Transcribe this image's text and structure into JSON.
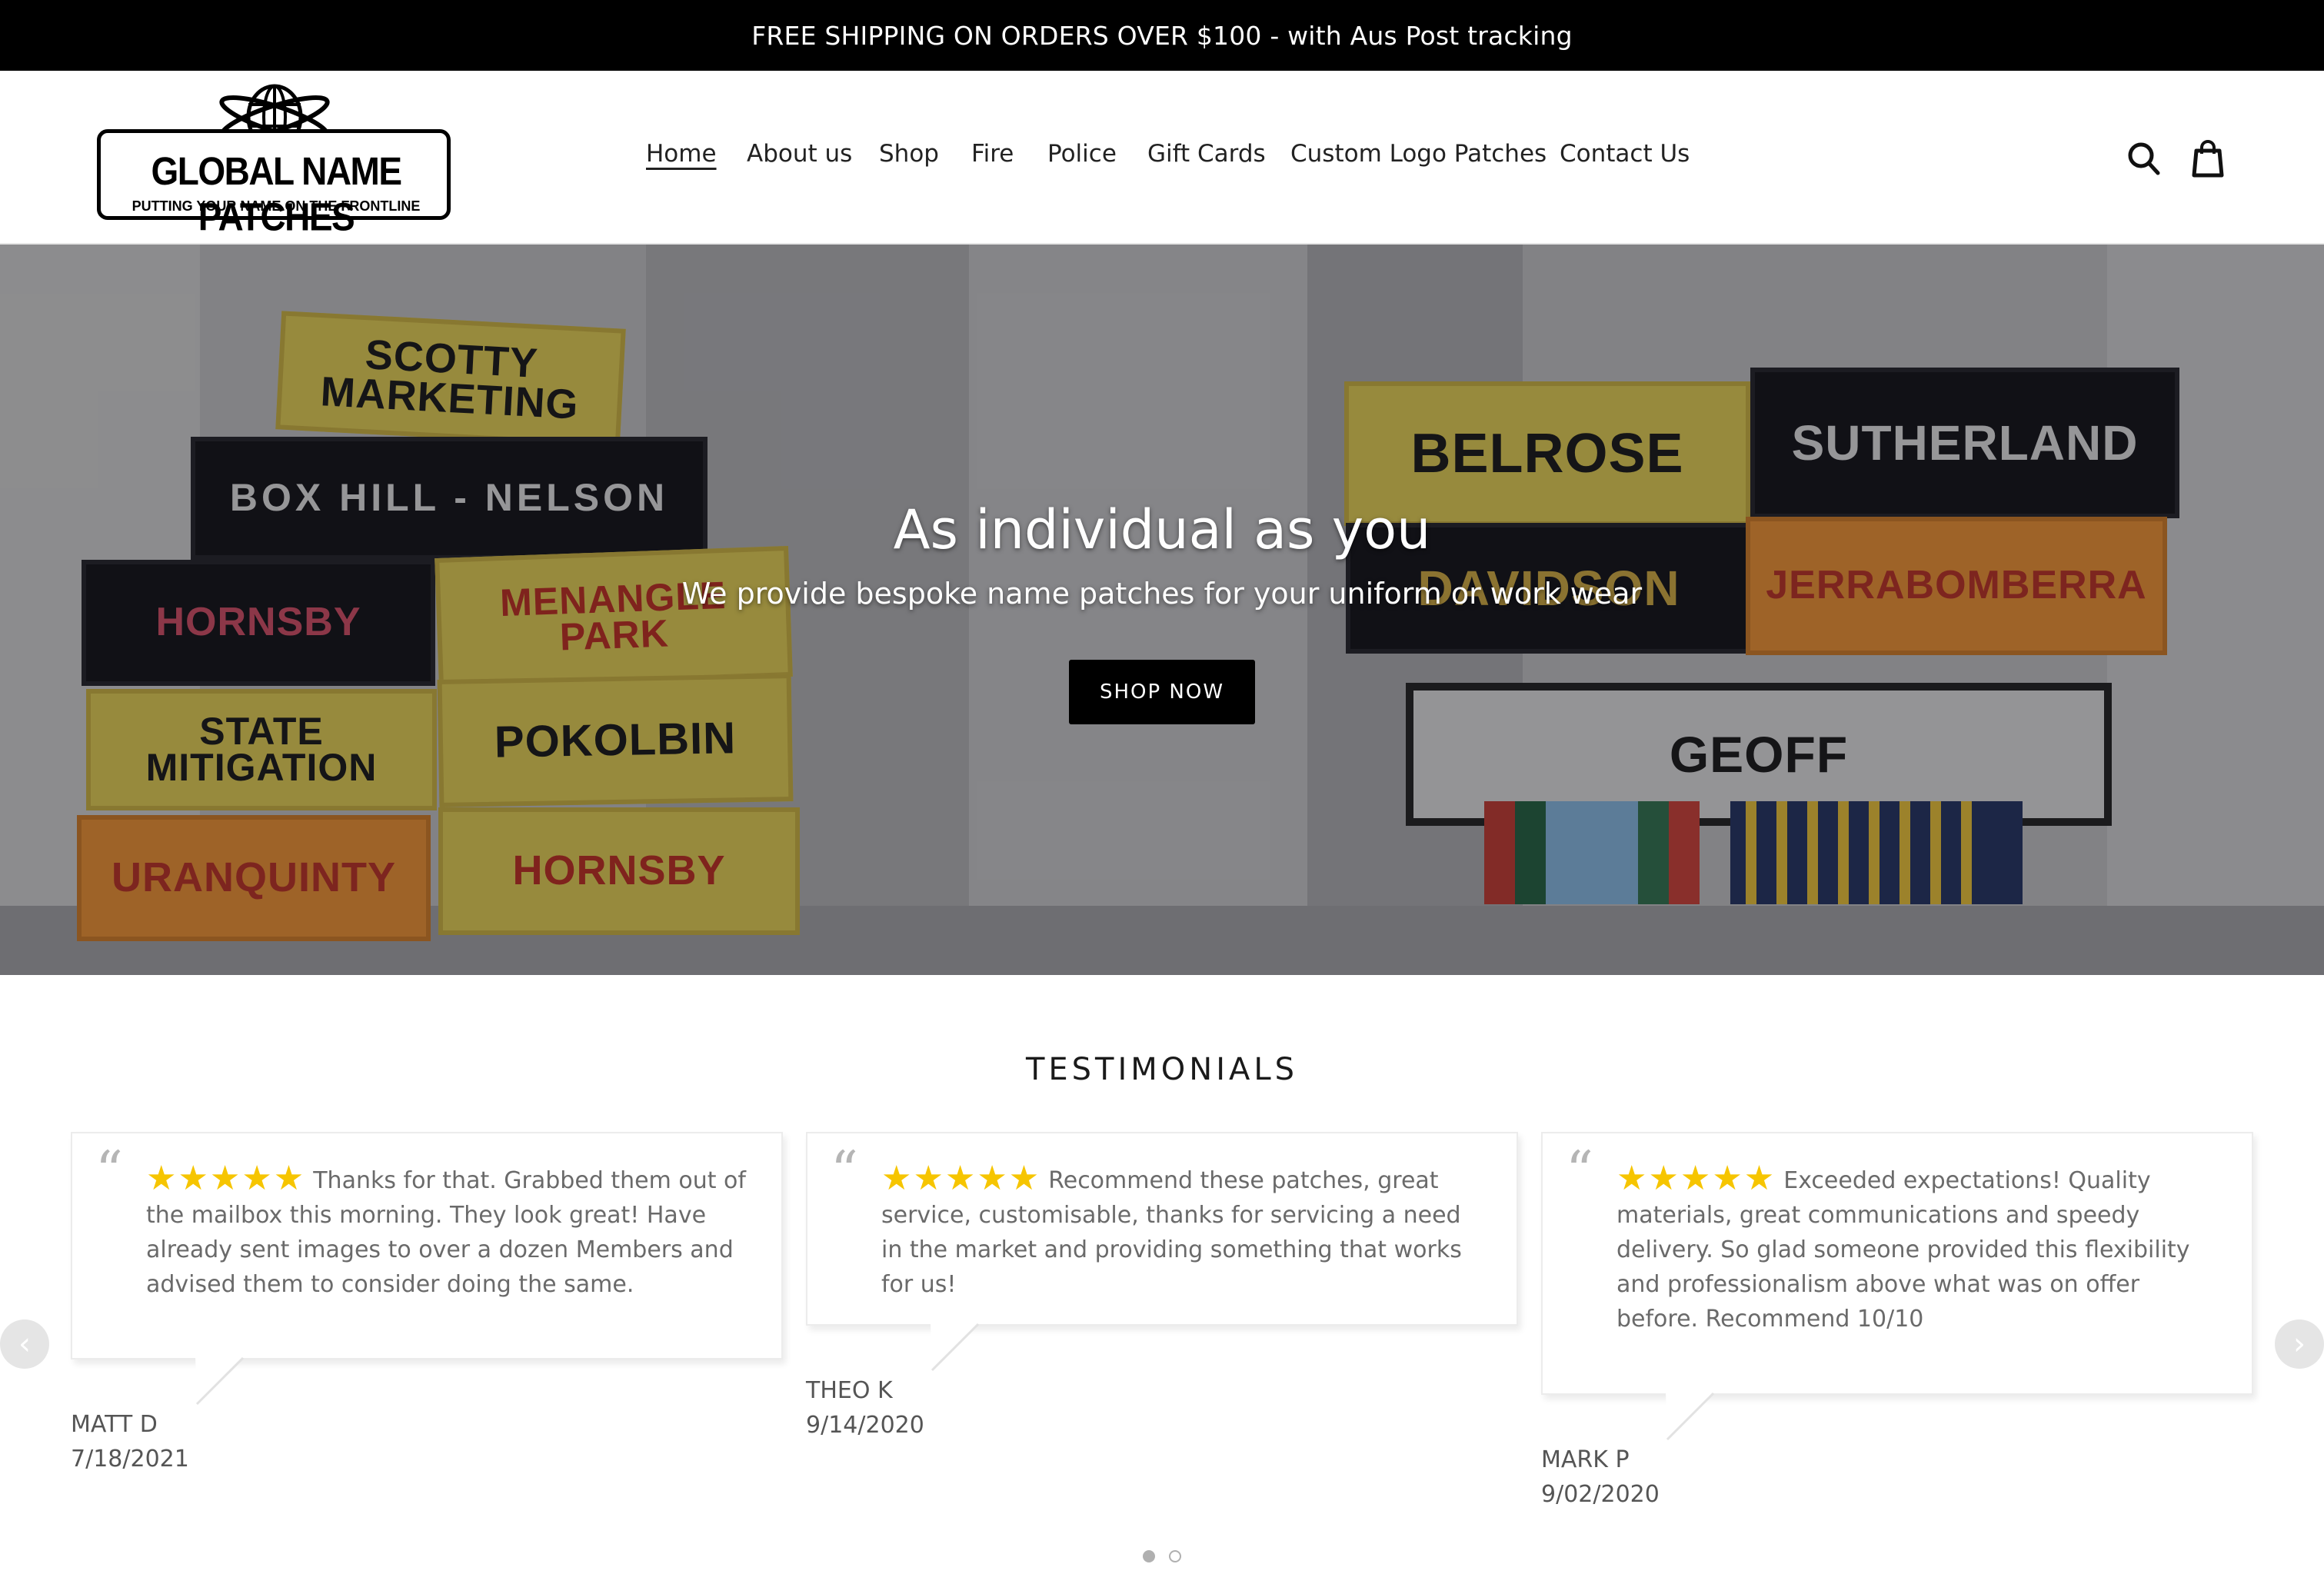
{
  "announcement": "FREE SHIPPING ON ORDERS OVER $100 - with Aus Post tracking",
  "logo": {
    "title": "GLOBAL NAME PATCHES",
    "tagline": "PUTTING YOUR NAME ON THE FRONTLINE"
  },
  "nav": [
    "Home",
    "About us",
    "Shop",
    "Fire",
    "Police",
    "Gift Cards",
    "Custom Logo Patches",
    "Contact Us"
  ],
  "icons": {
    "search": "search-icon",
    "cart": "cart-icon"
  },
  "hero": {
    "title": "As individual as you",
    "subtitle": "We provide bespoke name patches for your uniform or work wear",
    "button": "SHOP NOW",
    "patches_left": [
      "SCOTTY MARKETING",
      "BOX HILL - NELSON",
      "HORNSBY",
      "MENANGLE PARK",
      "STATE MITIGATION",
      "POKOLBIN",
      "URANQUINTY",
      "HORNSBY"
    ],
    "patches_right": [
      "BELROSE",
      "SUTHERLAND",
      "DAVIDSON",
      "JERRABOMBERRA",
      "GEOFF"
    ]
  },
  "testimonials": {
    "heading": "TESTIMONIALS",
    "items": [
      {
        "stars": "★★★★★",
        "text": "Thanks for that. Grabbed them out of the mailbox this morning. They look great! Have already sent images to over a dozen Members and advised them to consider doing the same.",
        "name": "MATT D",
        "date": "7/18/2021"
      },
      {
        "stars": "★★★★★",
        "text": "Recommend these patches, great service, customisable, thanks for servicing a need in the market and providing something that works for us!",
        "name": "THEO K",
        "date": "9/14/2020"
      },
      {
        "stars": "★★★★★",
        "text": "Exceeded expectations! Quality materials, great communications and speedy delivery. So glad someone provided this flexibility and professionalism above what was on offer before. Recommend 10/10",
        "name": "MARK P",
        "date": "9/02/2020"
      }
    ],
    "quote_glyph": "“",
    "prev": "‹",
    "next": "›"
  },
  "colors": {
    "accent": "#000000",
    "star": "#f6c500",
    "text_muted": "#6a6a6a"
  }
}
